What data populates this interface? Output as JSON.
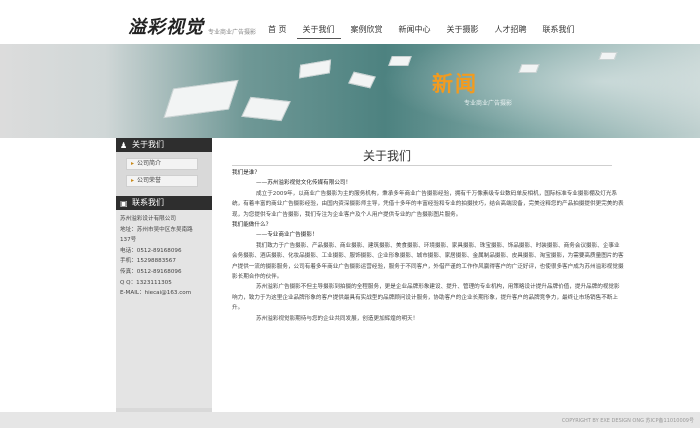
{
  "header": {
    "logo_text": "溢彩视觉",
    "slogan": "专业商业广告摄影",
    "nav": [
      "首 页",
      "关于我们",
      "案例欣赏",
      "新闻中心",
      "关于摄影",
      "人才招聘",
      "联系我们"
    ],
    "active_nav": "关于我们"
  },
  "banner": {
    "title": "新闻",
    "subtitle": "专业商业广告摄影"
  },
  "sidebar": {
    "about_header": "关于我们",
    "menu": [
      "公司简介",
      "公司荣誉"
    ],
    "contact_header": "联系我们",
    "contact_lines": [
      "苏州溢彩设计有限公司",
      "地址：苏州市吴中区东吴南路",
      "137号",
      "电话：0512-89168096",
      "手机：15298883567",
      "传真：0512-89168096",
      "Q Q：1323111305",
      "E-MAIL：hiecai@163.com"
    ]
  },
  "main": {
    "title": "关于我们",
    "paragraphs": [
      "我们是谁？",
      "——苏州溢彩视觉文化传媒有限公司！",
      "成立于2009年，以商业广告摄影为主的服务机构，秉承多年商业广告摄影经验，拥有千万像素级专业数码单反相机，国际标准专业摄影棚及灯光系统，有着丰富的商业广告摄影经验，由国内资深摄影师主导，凭借十多年的丰富经验和专业的拍摄技巧，结合高端设备，完美诠释您的产品拍摄提供更完美的表现，为您提供专业广告摄影，我们专注为企业客户及个人用户提供专业的广告摄影图片服务。",
      "我们能做什么？",
      "——专业商业广告摄影！",
      "我们致力于广告摄影、产品摄影、商业摄影、建筑摄影、美食摄影、环境摄影、家具摄影、珠宝摄影、饰品摄影、时装摄影、商务会议摄影、企事业会务摄影、酒店摄影、化妆品摄影、工业摄影、服饰摄影、企业形象摄影、城市摄影、家居摄影、金属制品摄影、皮具摄影、淘宝摄影，为需要高质量图片的客户提供一流的摄影服务，公司有着多年商业广告摄影运营经验，服务于不同客户，外借严谨的工作作风赢得客户的广泛好评，也使很多客户成为苏州溢彩视觉摄影长期合作的伙伴。",
      "苏州溢彩广告摄影不但主导摄影到拍摄的全程服务，更是企业品牌形象建设、提升、管理的专业机构，用策略设计提升品牌价值，提升品牌的视觉影响力，致力于为这里企业品牌形象的客户提供最具有实战型的品牌顾问设计服务，协助客户的企业长期形象，提升客户的品牌竞争力，最终让市场销售不断上升。",
      "苏州溢彩视觉影期待与您的企业共同发展，创造更加辉煌的明天！"
    ],
    "para_styles": [
      "bold",
      "bold",
      "indent",
      "bold",
      "bold",
      "indent",
      "indent",
      "indent"
    ]
  },
  "footer": {
    "copyright": "COPYRIGHT BY EXE DESIGN ONG 苏ICP备11010009号"
  },
  "colors": {
    "banner_title": "#f39b1e",
    "sidebar_header": "#2e2e2e",
    "sidebar_bg": "#d9d9d9"
  }
}
